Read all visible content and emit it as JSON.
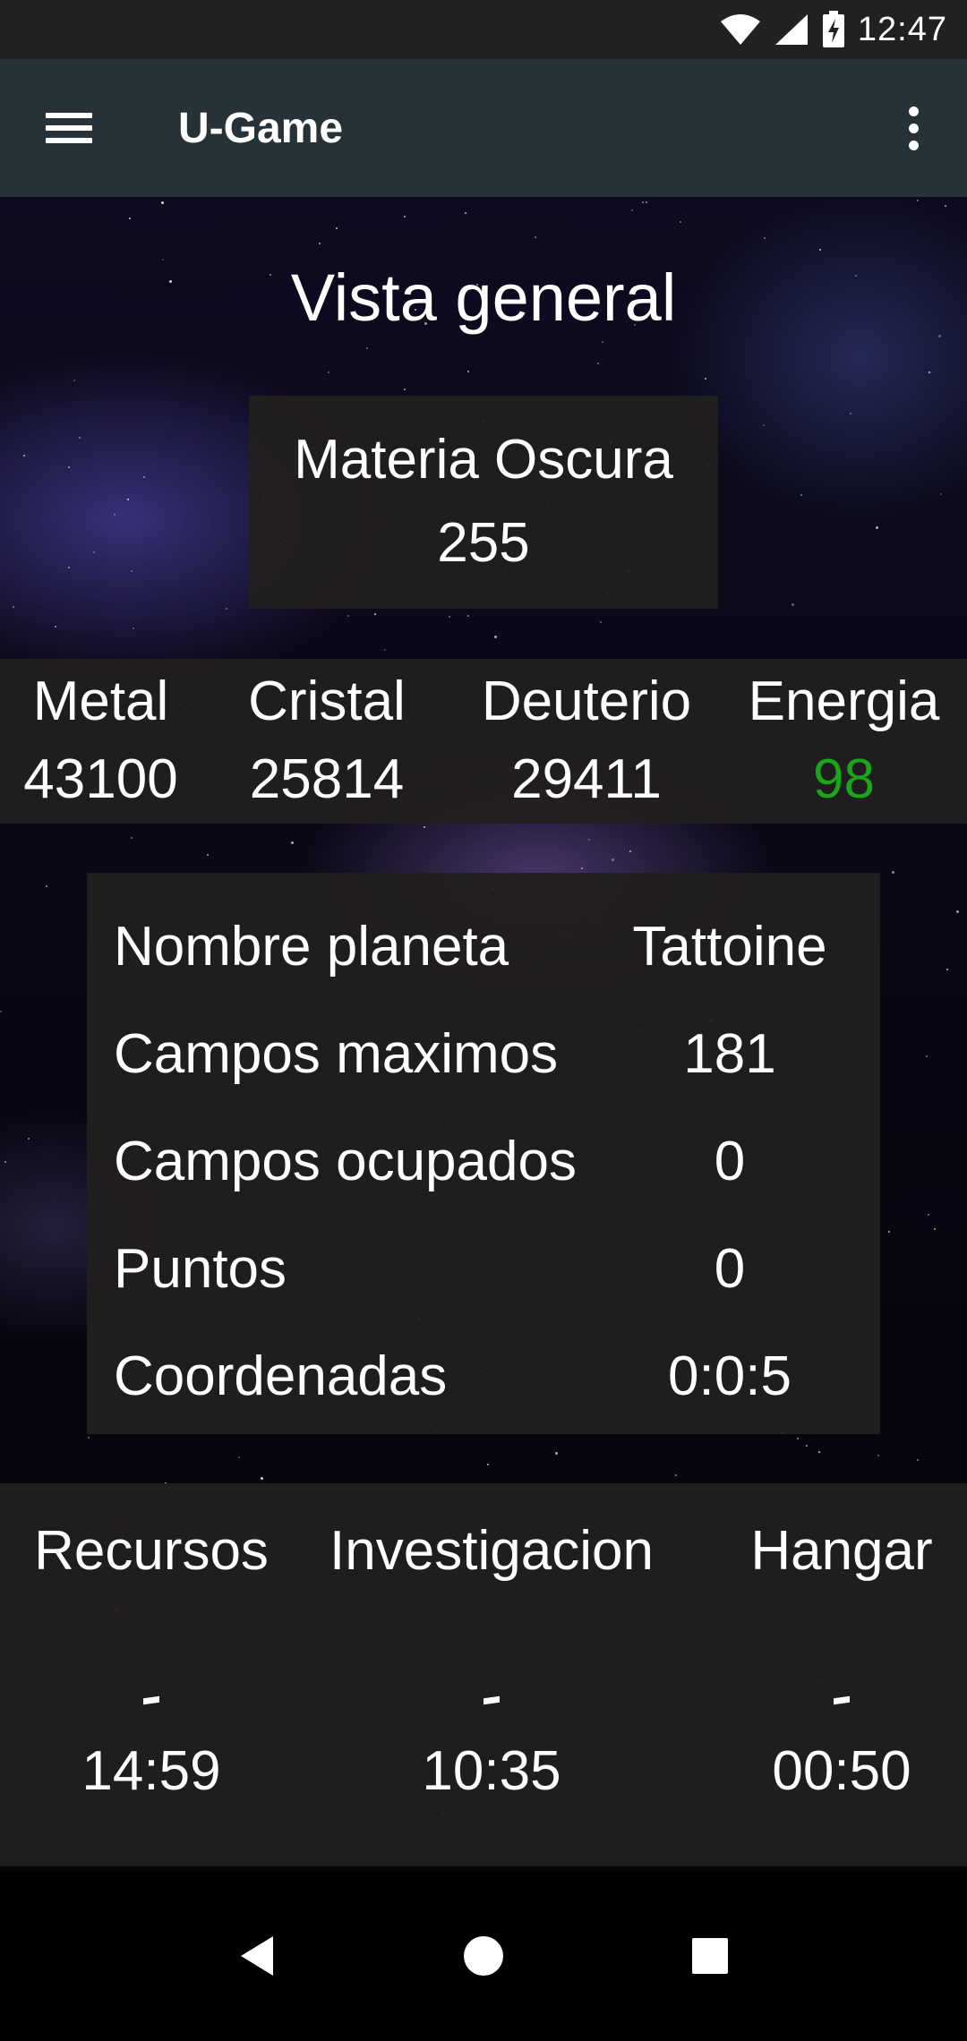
{
  "status_bar": {
    "time": "12:47"
  },
  "app_bar": {
    "title": "U-Game"
  },
  "page_title": "Vista general",
  "dark_matter": {
    "label": "Materia Oscura",
    "value": "255"
  },
  "resources": [
    {
      "name": "Metal",
      "amount": "43100",
      "color": "#ffffff"
    },
    {
      "name": "Cristal",
      "amount": "25814",
      "color": "#ffffff"
    },
    {
      "name": "Deuterio",
      "amount": "29411",
      "color": "#ffffff"
    },
    {
      "name": "Energia",
      "amount": "98",
      "color": "#1aa51a"
    }
  ],
  "planet": [
    {
      "label": "Nombre planeta",
      "value": "Tattoine"
    },
    {
      "label": "Campos maximos",
      "value": "181"
    },
    {
      "label": "Campos ocupados",
      "value": "0"
    },
    {
      "label": "Puntos",
      "value": "0"
    },
    {
      "label": "Coordenadas",
      "value": "0:0:5"
    }
  ],
  "queues": [
    {
      "name": "Recursos",
      "status": "-",
      "time": "14:59"
    },
    {
      "name": "Investigacion",
      "status": "-",
      "time": "10:35"
    },
    {
      "name": "Hangar",
      "status": "-",
      "time": "00:50"
    }
  ],
  "icons": {
    "wifi": "wifi-icon",
    "signal": "signal-icon",
    "battery": "battery-charging-icon",
    "menu": "menu-icon",
    "more": "more-vert-icon",
    "back": "back-icon",
    "home": "home-icon",
    "recents": "recents-icon"
  }
}
